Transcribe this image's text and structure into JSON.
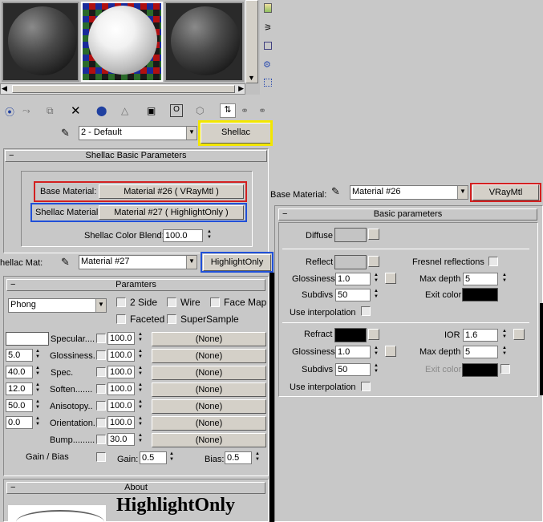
{
  "slots": {
    "sample_left": "dark-sphere",
    "sample_active": "white-sphere-on-checker",
    "sample_right": "dark-sphere"
  },
  "toolbar": {
    "icons": [
      "get-material-icon",
      "put-to-scene-icon",
      "assign-material-icon",
      "reset-map-icon",
      "delete-icon",
      "make-unique-icon",
      "put-to-library-icon",
      "material-id-icon",
      "show-map-icon",
      "show-end-result-icon",
      "go-to-parent-icon",
      "go-forward-icon"
    ]
  },
  "material_bar": {
    "name": "2 - Default",
    "type_button": "Shellac"
  },
  "shellac": {
    "header": "Shellac Basic Parameters",
    "base_label": "Base Material:",
    "base_value": "Material #26  ( VRayMtl )",
    "shellac_label": "Shellac Material:",
    "shellac_value": "Material #27  ( HighlightOnly )",
    "blend_label": "Shellac Color Blend:",
    "blend_value": "100.0"
  },
  "shellac_mat_bar": {
    "label": "hellac Mat:",
    "name": "Material #27",
    "type_button": "HighlightOnly"
  },
  "params": {
    "header": "Paramters",
    "shader": "Phong",
    "cb_2side": "2 Side",
    "cb_wire": "Wire",
    "cb_facemap": "Face Map",
    "cb_faceted": "Faceted",
    "cb_supersample": "SuperSample",
    "rows": [
      {
        "value": "",
        "label": "Specular....",
        "amount": "100.0",
        "map": "(None)"
      },
      {
        "value": "5.0",
        "label": "Glossiness.",
        "amount": "100.0",
        "map": "(None)"
      },
      {
        "value": "40.0",
        "label": "Spec.",
        "amount": "100.0",
        "map": "(None)"
      },
      {
        "value": "12.0",
        "label": "Soften.......",
        "amount": "100.0",
        "map": "(None)"
      },
      {
        "value": "50.0",
        "label": "Anisotopy..",
        "amount": "100.0",
        "map": "(None)"
      },
      {
        "value": "0.0",
        "label": "Orientation.",
        "amount": "100.0",
        "map": "(None)"
      },
      {
        "value": "",
        "label": "Bump.........",
        "amount": "30.0",
        "map": "(None)"
      }
    ],
    "gainbias_label": "Gain / Bias",
    "gain_label": "Gain:",
    "gain_value": "0.5",
    "bias_label": "Bias:",
    "bias_value": "0.5"
  },
  "about": {
    "header": "About",
    "title": "HighlightOnly"
  },
  "base_bar": {
    "label": "Base Material:",
    "name": "Material #26",
    "type_button": "VRayMtl"
  },
  "basic": {
    "header": "Basic parameters",
    "diffuse": "Diffuse",
    "reflect": "Reflect",
    "fresnel": "Fresnel reflections",
    "glossiness": "Glossiness",
    "refl_gloss": "1.0",
    "maxdepth": "Max depth",
    "refl_maxdepth": "5",
    "subdivs": "Subdivs",
    "refl_subdivs": "50",
    "exitcolor": "Exit color",
    "use_interp": "Use interpolation",
    "refract": "Refract",
    "ior": "IOR",
    "ior_value": "1.6",
    "refr_gloss": "1.0",
    "refr_maxdepth": "5",
    "refr_subdivs": "50"
  },
  "colors": {
    "highlight_yellow": "#f2e600",
    "highlight_red": "#d32020",
    "highlight_blue": "#2050d8"
  }
}
